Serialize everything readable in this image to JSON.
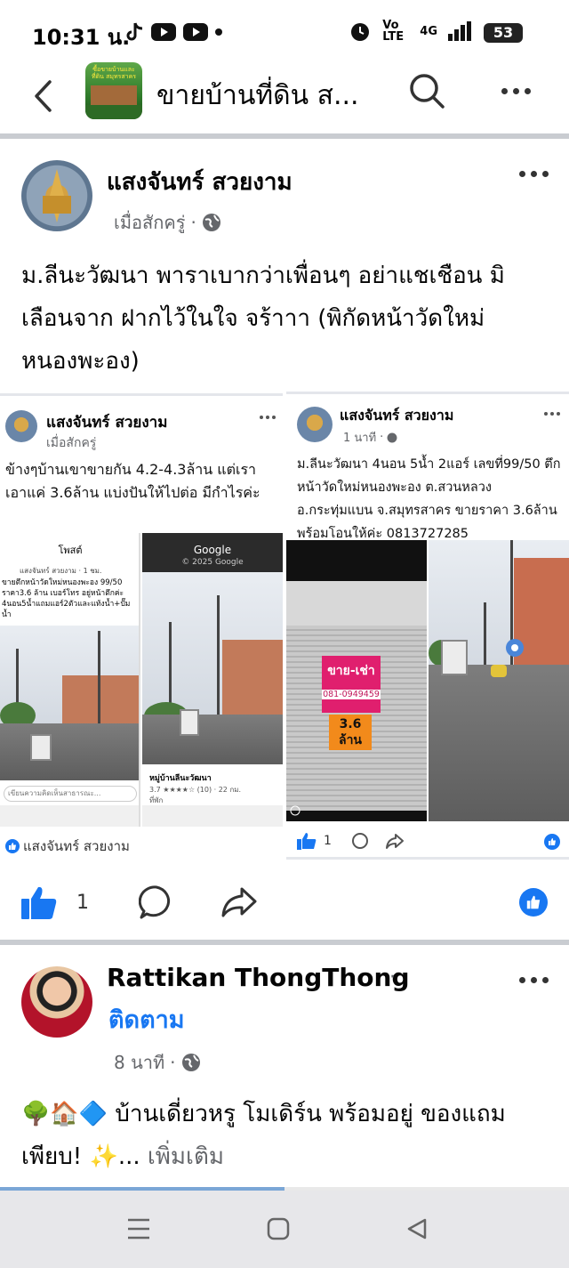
{
  "status_bar": {
    "time": "10:31 น.",
    "network_label": "Vo LTE",
    "signal_label": "4G",
    "battery": "53"
  },
  "header": {
    "group_title": "ขายบ้านที่ดิน ส...",
    "group_thumb_text": "ซื้อขายบ้านและที่ดิน สมุทรสาคร"
  },
  "post1": {
    "author": "แสงจันทร์ สวยงาม",
    "time": "เมื่อสักครู่",
    "text": "ม.ลีนะวัฒนา พาราเบากว่าเพื่อนๆ อย่าแชเชือน มิเลือนจาก ฝากไว้ในใจ จร้าาา (พิกัดหน้าวัดใหม่หนองพะอง)",
    "left_card": {
      "author": "แสงจันทร์ สวยงาม",
      "time": "เมื่อสักครู่",
      "text": "ข้างๆบ้านเขาขายกัน 4.2-4.3ล้าน แต่เราเอาแค่ 3.6ล้าน แบ่งปันให้ไปต่อ มีกำไรค่ะ",
      "inner_left_header": "โพสต์",
      "inner_left_name": "แสงจันทร์ สวยงาม · 1 ชม.",
      "inner_left_text": "ขายตึกหน้าวัดใหม่หนองพะอง 99/50 ราคา3.6 ล้าน เบอร์โทร อยู่หน้าตึกค่ะ 4นอน5น้ำแถมแอร์2ตัวและแท้งน้ำ+ปั๊มน้ำ",
      "inner_left_comment": "เขียนความคิดเห็นสาธารณะ...",
      "inner_right_header": "Google",
      "inner_right_copyright": "© 2025 Google",
      "inner_right_place": "หมู่บ้านลีนะวัฒนา",
      "inner_right_rating": "3.7 ★★★★☆ (10) · 22 กม.",
      "inner_right_sub": "ที่พัก",
      "footer_name": "แสงจันทร์ สวยงาม"
    },
    "right_card": {
      "author": "แสงจันทร์ สวยงาม",
      "time": "1 นาที",
      "text": "ม.ลีนะวัฒนา 4นอน 5น้ำ 2แอร์ เลขที่99/50 ตึกหน้าวัดใหม่หนองพะอง ต.สวนหลวง อ.กระทุ่มแบน จ.สมุทรสาคร ขายราคา 3.6ล้าน พร้อมโอนให้ค่ะ 0813727285",
      "sign_title": "ขาย-เช่า",
      "sign_phone": "081-0949459",
      "sign_price": "3.6 ล้าน",
      "like_count": "1"
    },
    "like_count": "1"
  },
  "post2": {
    "author": "Rattikan ThongThong",
    "follow_label": "ติดตาม",
    "time": "8 นาที",
    "text": "🌳🏠🔷 บ้านเดี่ยวหรู โมเดิร์น พร้อมอยู่ ของแถมเพียบ! ✨...",
    "more_label": "เพิ่มเติม"
  }
}
